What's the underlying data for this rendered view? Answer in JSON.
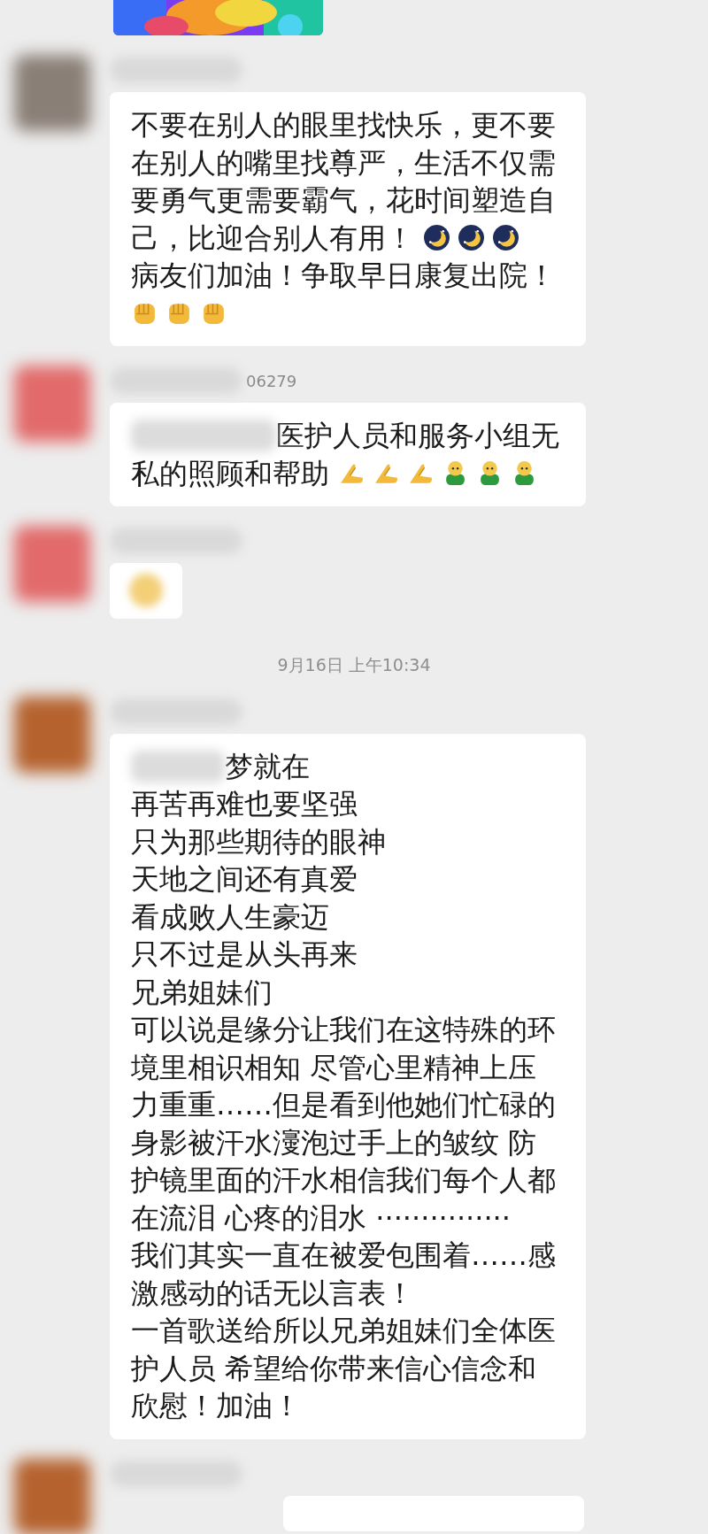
{
  "items": [
    {
      "kind": "message",
      "avatar": {
        "color": "#8a7f76"
      },
      "blocks": [
        {
          "kind": "text",
          "text": "不要在别人的眼里找快乐，更不要在别人的嘴里找尊严，生活不仅需要勇气更需要霸气，花时间塑造自"
        },
        {
          "kind": "row",
          "parts": [
            {
              "kind": "text",
              "text": "己，比迎合别人有用！"
            },
            {
              "kind": "moon"
            },
            {
              "kind": "moon"
            },
            {
              "kind": "moon"
            }
          ]
        },
        {
          "kind": "text",
          "text": "病友们加油！争取早日康复出院！"
        },
        {
          "kind": "row",
          "parts": [
            {
              "kind": "fist"
            },
            {
              "kind": "fist"
            },
            {
              "kind": "fist"
            }
          ]
        }
      ]
    },
    {
      "kind": "message",
      "avatar": {
        "color": "#e26a6a"
      },
      "name_visible": "06279",
      "blocks": [
        {
          "kind": "row",
          "parts": [
            {
              "kind": "blur"
            },
            {
              "kind": "text",
              "text": "医护人员和服务小组无"
            }
          ]
        },
        {
          "kind": "row",
          "parts": [
            {
              "kind": "text",
              "text": "私的照顾和帮助"
            },
            {
              "kind": "pray"
            },
            {
              "kind": "pray"
            },
            {
              "kind": "pray"
            },
            {
              "kind": "figure"
            },
            {
              "kind": "figure"
            },
            {
              "kind": "figure"
            }
          ]
        }
      ]
    },
    {
      "kind": "message",
      "avatar": {
        "color": "#e26a6a"
      },
      "blocks": [
        {
          "kind": "row",
          "parts": [
            {
              "kind": "blurred_emoji"
            }
          ]
        }
      ]
    },
    {
      "kind": "timestamp",
      "text": "9月16日 上午10:34"
    },
    {
      "kind": "message",
      "avatar": {
        "color": "#b5622e"
      },
      "blocks": [
        {
          "kind": "row",
          "parts": [
            {
              "kind": "blur_short"
            },
            {
              "kind": "text",
              "text": "梦就在"
            }
          ]
        },
        {
          "kind": "text",
          "text": "再苦再难也要坚强"
        },
        {
          "kind": "text",
          "text": "只为那些期待的眼神"
        },
        {
          "kind": "text",
          "text": "天地之间还有真爱"
        },
        {
          "kind": "text",
          "text": "看成败人生豪迈"
        },
        {
          "kind": "text",
          "text": "只不过是从头再来"
        },
        {
          "kind": "text",
          "text": "兄弟姐妹们"
        },
        {
          "kind": "text",
          "text": "可以说是缘分让我们在这特殊的环境里相识相知 尽管心里精神上压力重重……但是看到他她们忙碌的身影被汗水濅泡过手上的皱纹 防护镜里面的汗水相信我们每个人都在流泪 心疼的泪水 ···············"
        },
        {
          "kind": "text",
          "text": "我们其实一直在被爱包围着……感激感动的话无以言表！"
        },
        {
          "kind": "text",
          "text": "一首歌送给所以兄弟姐妹们全体医护人员 希望给你带来信心信念和欣慰！加油！"
        }
      ]
    },
    {
      "kind": "partial",
      "avatar": {
        "color": "#b5622e"
      }
    }
  ]
}
